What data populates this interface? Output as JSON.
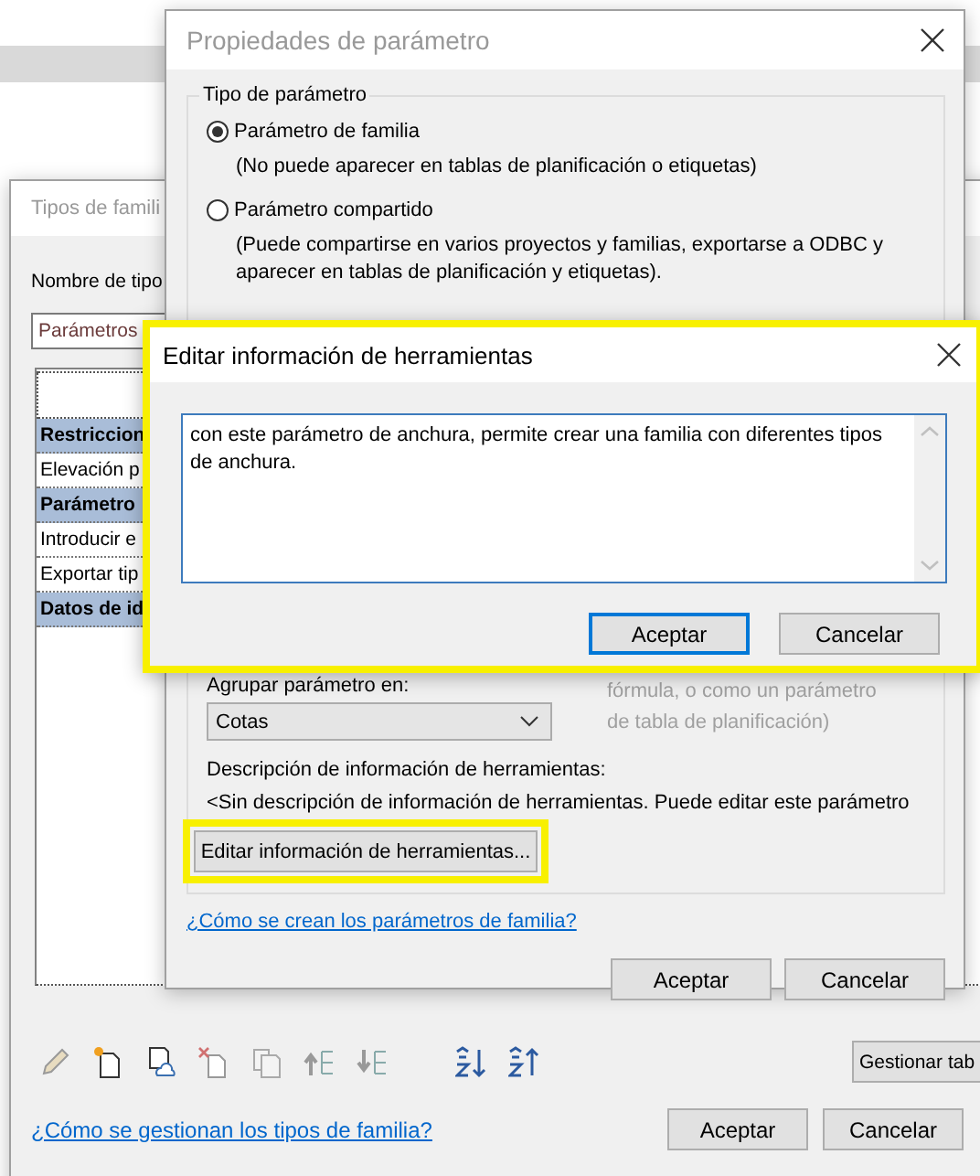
{
  "family_types_window": {
    "title": "Tipos de famili",
    "type_name_label": "Nombre de tipo",
    "type_name_value": "Parámetros",
    "table_rows": [
      {
        "kind": "group",
        "label": "Restriccion"
      },
      {
        "kind": "item",
        "label": "Elevación p"
      },
      {
        "kind": "group",
        "label": "Parámetro"
      },
      {
        "kind": "item",
        "label": "Introducir e"
      },
      {
        "kind": "item",
        "label": "Exportar tip"
      },
      {
        "kind": "group",
        "label": "Datos de id"
      }
    ],
    "toolbar": [
      {
        "kind": "pencil"
      },
      {
        "kind": "new"
      },
      {
        "kind": "cloud"
      },
      {
        "kind": "delete"
      },
      {
        "kind": "copy"
      },
      {
        "kind": "up"
      },
      {
        "kind": "down"
      },
      {
        "kind": "sort-asc"
      },
      {
        "kind": "sort-desc"
      }
    ],
    "manage_button": "Gestionar tab",
    "help_link": "¿Cómo se gestionan los tipos de familia?",
    "buttons": [
      "Aceptar",
      "Cancelar"
    ]
  },
  "parameter_properties_window": {
    "title": "Propiedades de parámetro",
    "type_group": "Tipo de parámetro",
    "radios": [
      {
        "label": "Parámetro de familia",
        "note": [
          "(No puede aparecer en tablas de planificación o etiquetas)"
        ],
        "selected": true
      },
      {
        "label": "Parámetro compartido",
        "note": [
          "(Puede compartirse en varios proyectos y familias, exportarse a ODBC y",
          "aparecer en tablas de planificación y etiquetas)."
        ],
        "selected": false
      }
    ],
    "group_label": "Agrupar parámetro en:",
    "group_value": "Cotas",
    "side_note": [
      "fórmula, o como un parámetro",
      "de tabla de planificación)"
    ],
    "tooltip_label": "Descripción de información de herramientas:",
    "tooltip_value": "<Sin descripción de información de herramientas. Puede editar este parámetro",
    "edit_button": {
      "label": "Editar información de herramientas...",
      "highlighted": true
    },
    "help_link": "¿Cómo se crean los parámetros de familia?",
    "buttons": [
      "Aceptar",
      "Cancelar"
    ]
  },
  "edit_tooltip_dialog": {
    "title": "Editar información de herramientas",
    "highlighted": true,
    "text": "con este parámetro de anchura, permite crear una familia con diferentes tipos de anchura.",
    "buttons": [
      {
        "label": "Aceptar",
        "default": true
      },
      {
        "label": "Cancelar",
        "default": false
      }
    ]
  }
}
